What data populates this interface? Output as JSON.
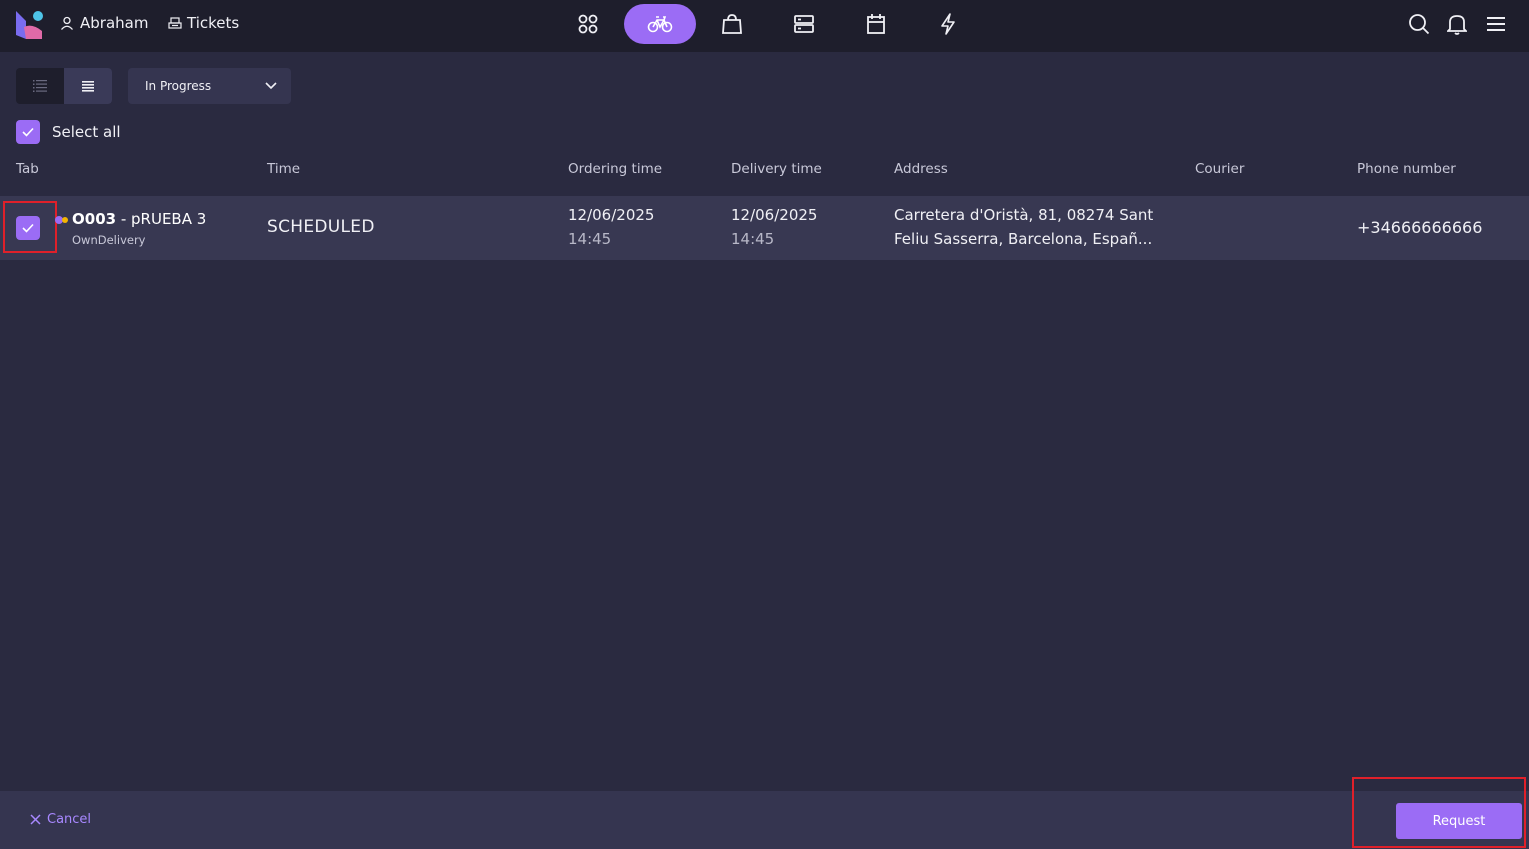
{
  "topbar": {
    "user_name": "Abraham",
    "tickets_label": "Tickets",
    "nav_icons": [
      "grid-icon",
      "bicycle-icon",
      "bag-icon",
      "server-icon",
      "calendar-icon",
      "lightning-icon"
    ],
    "active_nav": "bicycle-icon",
    "right_icons": [
      "search-icon",
      "bell-icon",
      "menu-icon"
    ]
  },
  "toolbar": {
    "status_filter": "In Progress",
    "select_all_label": "Select all"
  },
  "table": {
    "columns": [
      "Tab",
      "Time",
      "Ordering time",
      "Delivery time",
      "Address",
      "Courier",
      "Phone number"
    ],
    "rows": [
      {
        "order_id": "O003",
        "order_name": "- pRUEBA 3",
        "channel": "OwnDelivery",
        "time": "SCHEDULED",
        "ordering_date": "12/06/2025",
        "ordering_time": "14:45",
        "delivery_date": "12/06/2025",
        "delivery_time": "14:45",
        "address_line1": "Carretera d'Oristà, 81, 08274 Sant",
        "address_line2": "Feliu Sasserra, Barcelona, Españ...",
        "courier": "",
        "phone": "+34666666666"
      }
    ]
  },
  "footer": {
    "cancel_label": "Cancel",
    "request_label": "Request"
  },
  "colors": {
    "accent": "#9b6cf5",
    "background": "#2a2a40",
    "topbar": "#1e1e2c",
    "highlight": "#e0202a"
  }
}
